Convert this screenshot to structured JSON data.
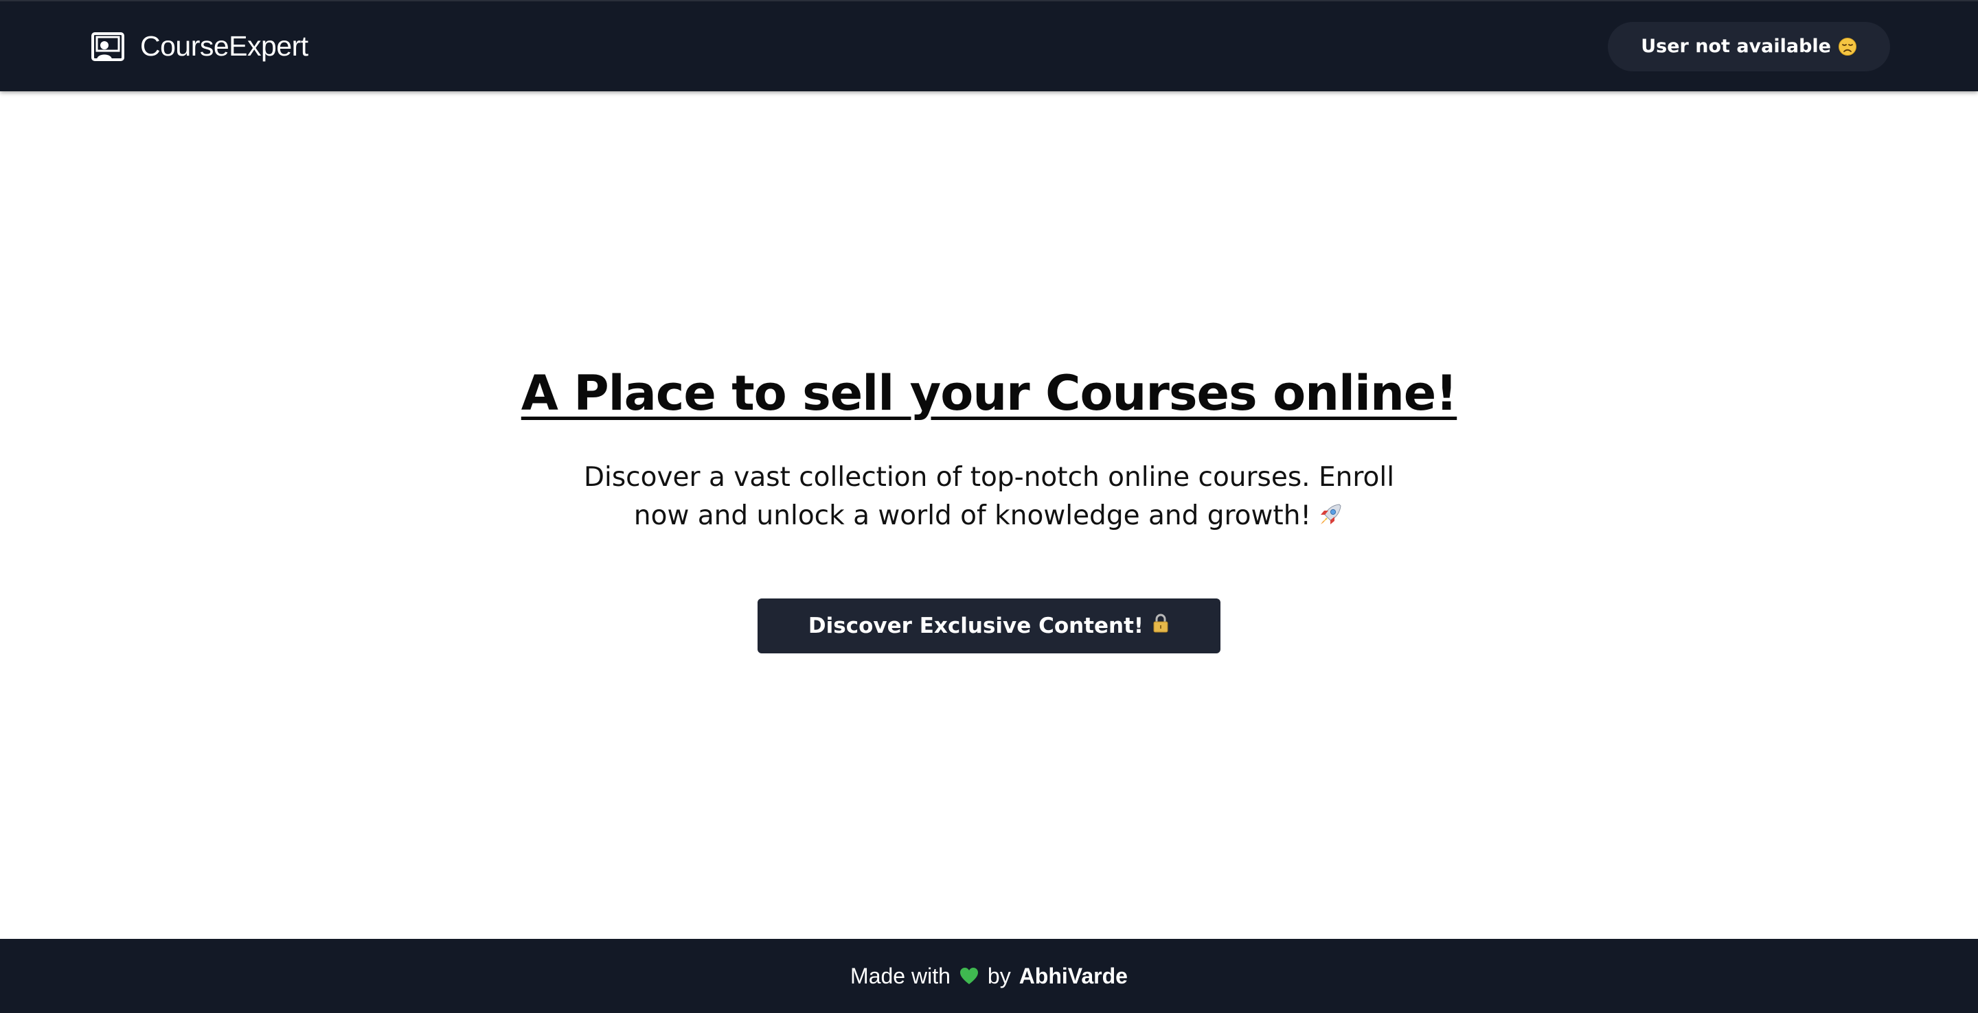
{
  "navbar": {
    "brand_name": "CourseExpert",
    "brand_icon": "presentation-board-icon",
    "user_status": "User not available",
    "user_status_emoji": "disappointed-face-icon"
  },
  "hero": {
    "title": "A Place to sell your Courses online!",
    "description": "Discover a vast collection of top-notch online courses. Enroll now and unlock a world of knowledge and growth!",
    "description_emoji": "rocket-icon",
    "cta_label": "Discover Exclusive Content!",
    "cta_emoji": "lock-icon"
  },
  "footer": {
    "made_with": "Made with",
    "heart_icon": "green-heart-icon",
    "by": "by",
    "author": "AbhiVarde"
  },
  "colors": {
    "nav_bg": "#131926",
    "button_bg": "#1f2533",
    "heart": "#3fb950",
    "text_dark": "#0a0a0a"
  }
}
